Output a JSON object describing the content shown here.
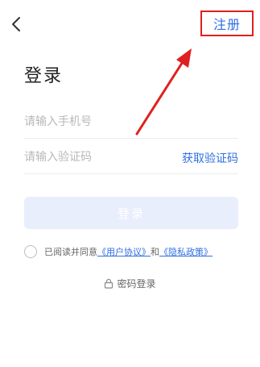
{
  "header": {
    "back_icon": "chevron-left-icon",
    "register_label": "注册"
  },
  "title": "登录",
  "form": {
    "phone_placeholder": "请输入手机号",
    "code_placeholder": "请输入验证码",
    "get_code_label": "获取验证码",
    "login_label": "登录"
  },
  "agreement": {
    "prefix": "已阅读并同意",
    "user_agreement": "《用户协议》",
    "and": "和",
    "privacy_policy": "《隐私政策》"
  },
  "password_login": {
    "icon": "lock-icon",
    "label": "密码登录"
  },
  "colors": {
    "accent": "#2f6fe0",
    "annotation": "#e02020",
    "button_disabled": "#e8eefc"
  }
}
